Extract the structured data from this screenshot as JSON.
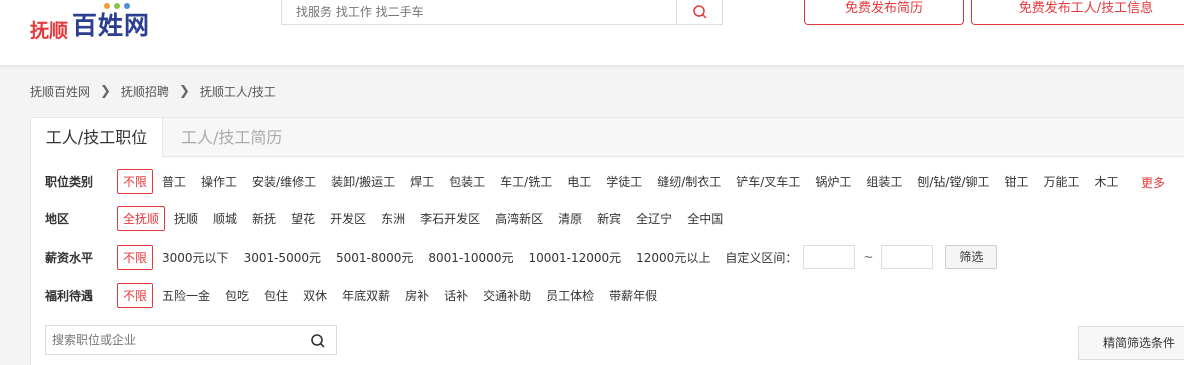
{
  "header": {
    "logo_small": "抚顺",
    "logo_big": "百姓网",
    "logo_dot_colors": [
      "#f0a030",
      "#8bc34a",
      "#4a90d9"
    ],
    "search_placeholder": "找服务 找工作 找二手车",
    "search_icon": "search-icon",
    "publish_resume": "免费发布简历",
    "publish_worker": "免费发布工人/技工信息"
  },
  "breadcrumb": [
    "抚顺百姓网",
    "抚顺招聘",
    "抚顺工人/技工"
  ],
  "tabs": [
    "工人/技工职位",
    "工人/技工简历"
  ],
  "filters": {
    "category": {
      "label": "职位类别",
      "selected": "不限",
      "options": [
        "普工",
        "操作工",
        "安装/维修工",
        "装卸/搬运工",
        "焊工",
        "包装工",
        "车工/铣工",
        "电工",
        "学徒工",
        "缝纫/制衣工",
        "铲车/叉车工",
        "锅炉工",
        "组装工",
        "刨/钻/镗/铆工",
        "钳工",
        "万能工",
        "木工"
      ],
      "more": "更多"
    },
    "area": {
      "label": "地区",
      "selected": "全抚顺",
      "options": [
        "抚顺",
        "顺城",
        "新抚",
        "望花",
        "开发区",
        "东洲",
        "李石开发区",
        "高湾新区",
        "清原",
        "新宾",
        "全辽宁",
        "全中国"
      ]
    },
    "salary": {
      "label": "薪资水平",
      "selected": "不限",
      "options": [
        "3000元以下",
        "3001-5000元",
        "5001-8000元",
        "8001-10000元",
        "10001-12000元",
        "12000元以上"
      ],
      "custom_label": "自定义区间：",
      "tilde": "~",
      "button": "筛选"
    },
    "welfare": {
      "label": "福利待遇",
      "selected": "不限",
      "options": [
        "五险一金",
        "包吃",
        "包住",
        "双休",
        "年底双薪",
        "房补",
        "话补",
        "交通补助",
        "员工体检",
        "带薪年假"
      ]
    }
  },
  "keyword_search": {
    "placeholder": "搜索职位或企业",
    "icon": "search-icon"
  },
  "advanced_button": "精简筛选条件",
  "colors": {
    "accent": "#e4393c",
    "brand_blue": "#2c3e8f"
  }
}
